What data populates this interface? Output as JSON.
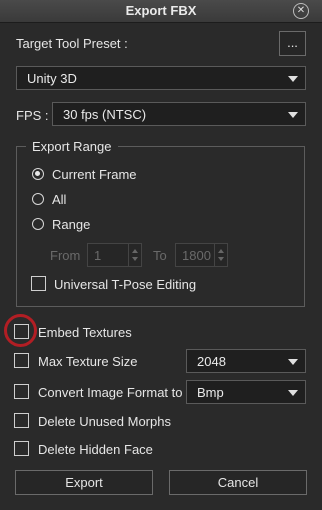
{
  "window": {
    "title": "Export FBX",
    "close_glyph": "⊗"
  },
  "preset": {
    "label": "Target Tool Preset :",
    "browse_label": "...",
    "selected": "Unity 3D"
  },
  "fps": {
    "label": "FPS :",
    "selected": "30 fps (NTSC)"
  },
  "export_range": {
    "title": "Export Range",
    "options": [
      {
        "label": "Current Frame",
        "selected": true
      },
      {
        "label": "All",
        "selected": false
      },
      {
        "label": "Range",
        "selected": false
      }
    ],
    "from_label": "From",
    "from_value": "1",
    "to_label": "To",
    "to_value": "1800",
    "tpose_label": "Universal T-Pose Editing"
  },
  "options": {
    "embed_textures": "Embed Textures",
    "max_texture_size": "Max Texture Size",
    "max_texture_value": "2048",
    "convert_format": "Convert Image Format to",
    "convert_format_value": "Bmp",
    "delete_morphs": "Delete Unused Morphs",
    "delete_face": "Delete Hidden Face"
  },
  "buttons": {
    "export": "Export",
    "cancel": "Cancel"
  },
  "colors": {
    "highlight": "#b21e24",
    "background": "#2a2a2a"
  }
}
